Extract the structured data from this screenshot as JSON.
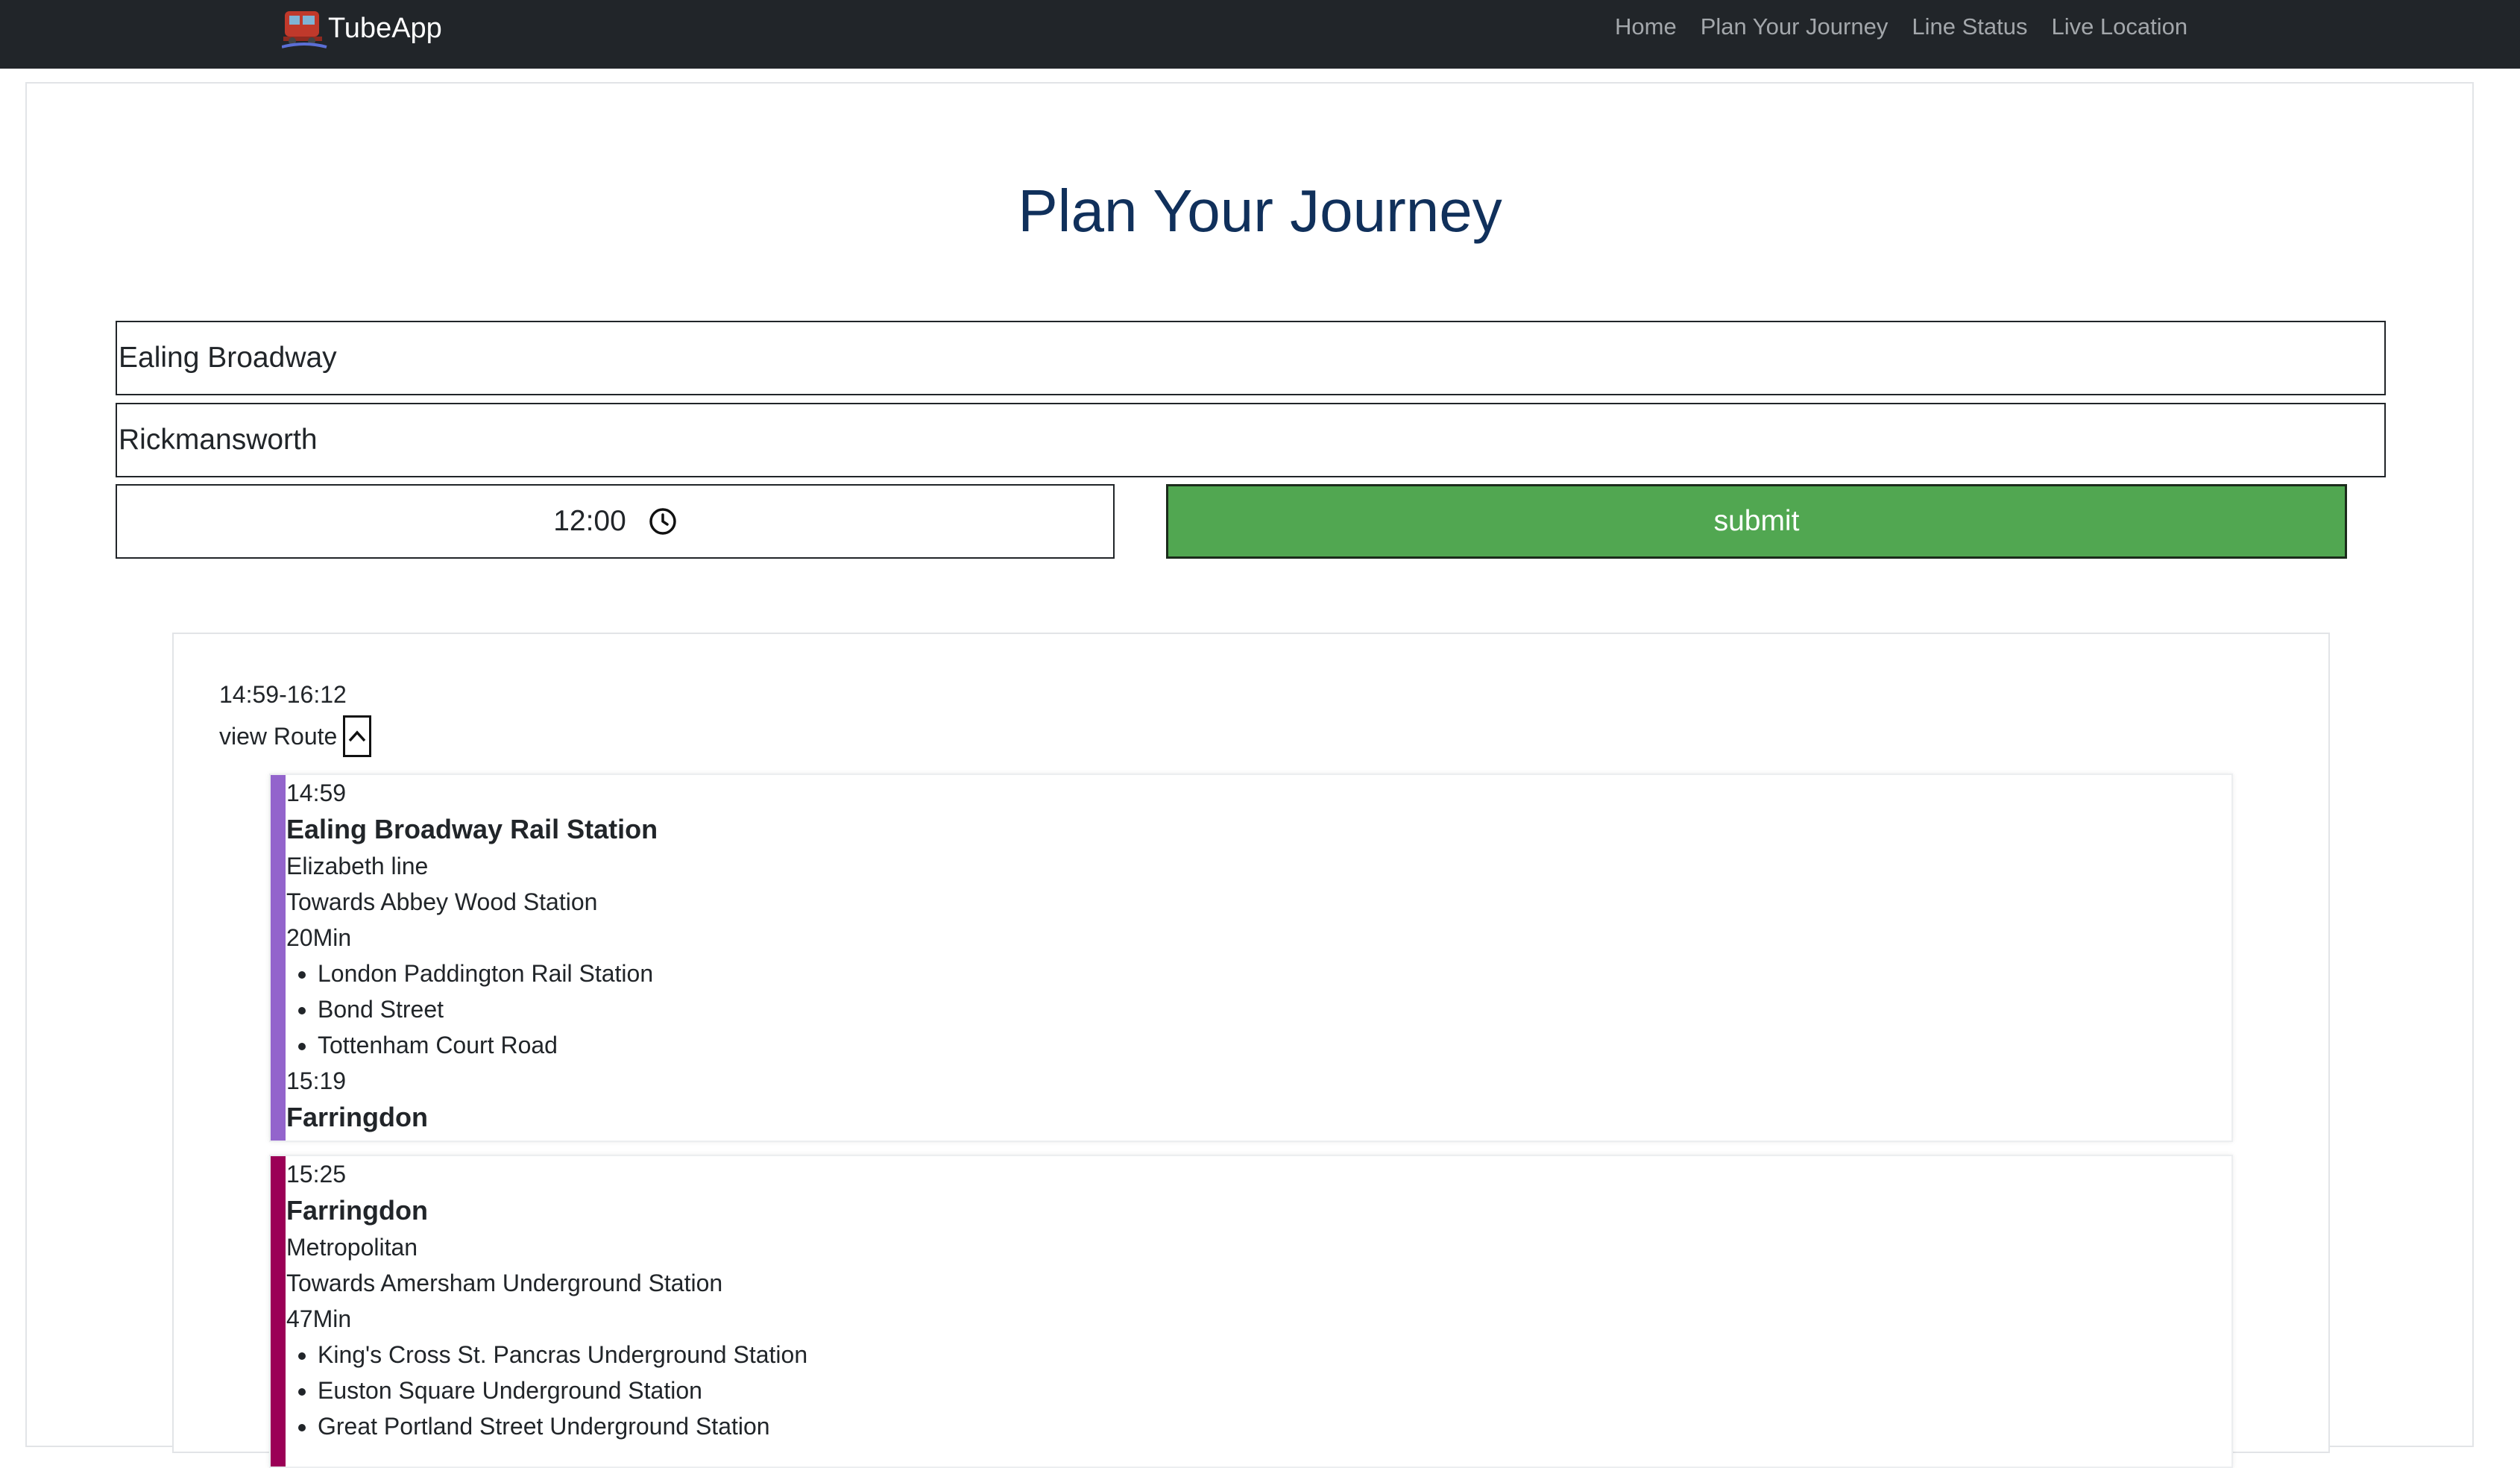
{
  "nav": {
    "brand": "TubeApp",
    "links": [
      "Home",
      "Plan Your Journey",
      "Line Status",
      "Live Location"
    ]
  },
  "main": {
    "title": "Plan Your Journey",
    "from_value": "Ealing Broadway",
    "to_value": "Rickmansworth",
    "time_value": "12:00",
    "submit_label": "submit"
  },
  "results": {
    "time_range": "14:59-16:12",
    "view_route_label": "view Route",
    "legs": [
      {
        "color": "#9364CC",
        "depart_time": "14:59",
        "from_station": "Ealing Broadway Rail Station",
        "line": "Elizabeth line",
        "direction": "Towards Abbey Wood Station",
        "duration": "20Min",
        "stops": [
          "London Paddington Rail Station",
          "Bond Street",
          "Tottenham Court Road"
        ],
        "arrive_time": "15:19",
        "to_station": "Farringdon"
      },
      {
        "color": "#9B0056",
        "depart_time": "15:25",
        "from_station": "Farringdon",
        "line": "Metropolitan",
        "direction": "Towards Amersham Underground Station",
        "duration": "47Min",
        "stops": [
          "King's Cross St. Pancras Underground Station",
          "Euston Square Underground Station",
          "Great Portland Street Underground Station"
        ]
      }
    ]
  },
  "icons": {
    "logo": "train-logo-icon",
    "clock": "clock-icon",
    "toggle": "chevron-up-icon"
  }
}
